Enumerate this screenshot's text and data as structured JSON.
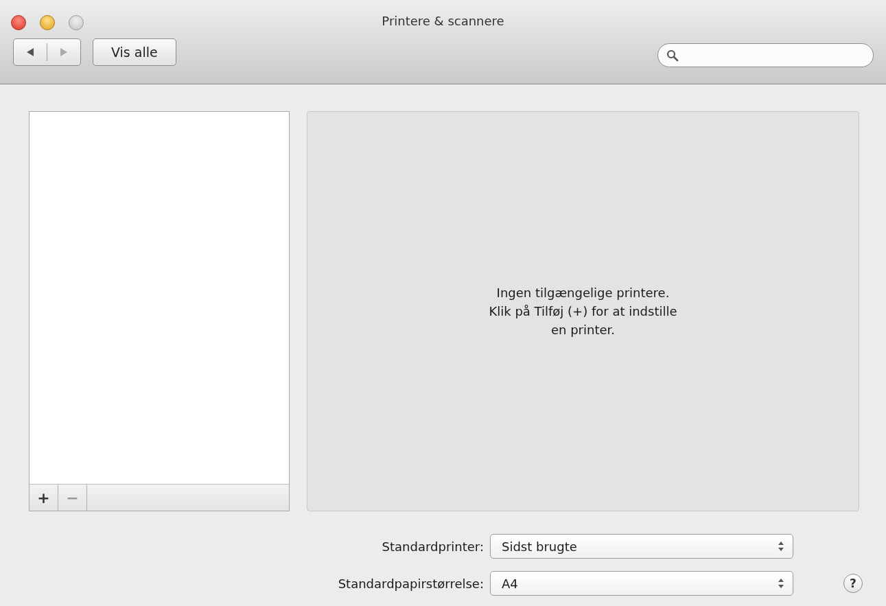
{
  "window": {
    "title": "Printere & scannere"
  },
  "toolbar": {
    "show_all_button": "Vis alle"
  },
  "printer_list": {
    "add_button": "+",
    "remove_button": "−"
  },
  "detail_panel": {
    "message": "Ingen tilgængelige printere.\nKlik på Tilføj (+) for at indstille\nen printer."
  },
  "settings": [
    {
      "label": "Standardprinter:",
      "value": "Sidst brugte"
    },
    {
      "label": "Standardpapirstørrelse:",
      "value": "A4"
    }
  ],
  "help_button": "?"
}
